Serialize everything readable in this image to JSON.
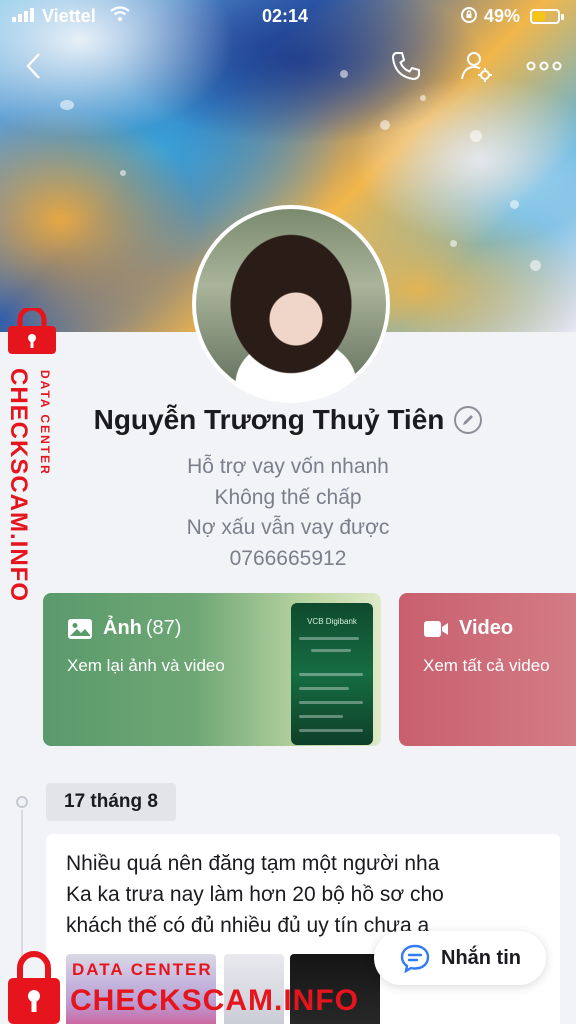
{
  "status_bar": {
    "carrier": "Viettel",
    "time": "02:14",
    "battery_percent": "49%",
    "battery_level": 0.49,
    "icons": [
      "signal-icon",
      "wifi-icon",
      "orientation-lock-icon",
      "battery-icon"
    ]
  },
  "header": {
    "icons": [
      "back-icon",
      "call-icon",
      "profile-settings-icon",
      "more-icon"
    ]
  },
  "profile": {
    "name": "Nguyễn Trương Thuỷ Tiên",
    "bio_lines": [
      "Hỗ trợ vay vốn nhanh",
      "Không thế chấp",
      "Nợ xấu vẫn vay được",
      "0766665912"
    ]
  },
  "media_cards": {
    "photo": {
      "title": "Ảnh",
      "count": "(87)",
      "subtitle": "Xem lại ảnh và video",
      "icon": "image-icon"
    },
    "video": {
      "title": "Video",
      "subtitle": "Xem tất cả video",
      "icon": "video-camera-icon"
    },
    "thumb_bank_label": "VCB Digibank"
  },
  "timeline": {
    "date": "17 tháng 8",
    "post_lines": [
      "Nhiều quá nên đăng tạm một người nha",
      "Ka ka trưa nay làm hơn 20 bộ hồ sơ cho",
      "khách thế có đủ nhiều đủ uy tín chưa a"
    ]
  },
  "chat_button": {
    "label": "Nhắn tin",
    "icon": "chat-bubble-icon"
  },
  "watermark": {
    "line1": "DATA CENTER",
    "line2": "CHECKSCAM.INFO",
    "color": "#e6141d"
  },
  "colors": {
    "photo_card": "#5a9a6b",
    "video_card": "#c95f6e",
    "page_bg": "#f2f3f7"
  }
}
